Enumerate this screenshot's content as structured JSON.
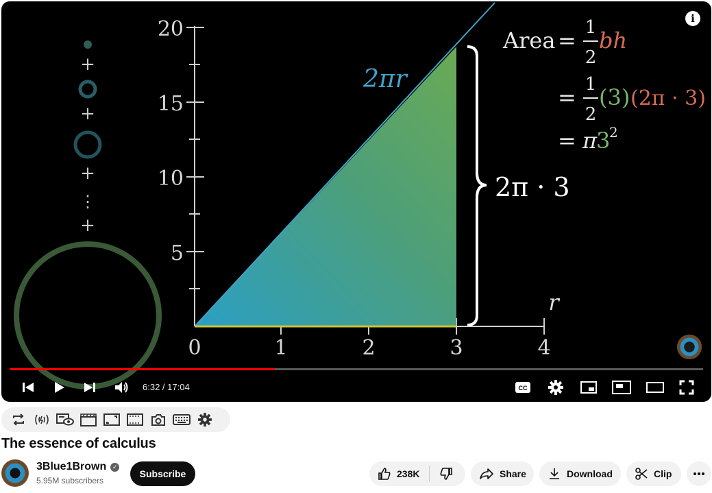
{
  "video": {
    "equations": {
      "area_word": "Area",
      "equals": "=",
      "half_num": "1",
      "half_den": "2",
      "bh": "bh",
      "three_paren": "(3)",
      "two_pi_three_paren": "(2π · 3)",
      "pi": "π",
      "three_sq": "3",
      "sq_exp": "2"
    },
    "labels": {
      "hypotenuse": "2πr",
      "brace": "2π · 3",
      "r_axis": "r"
    },
    "plot": {
      "x_ticks": [
        "0",
        "1",
        "2",
        "3",
        "4"
      ],
      "y_ticks": [
        "5",
        "10",
        "15",
        "20"
      ]
    },
    "info_icon": "i"
  },
  "player": {
    "progress_fraction": 0.382,
    "time_current": "6:32",
    "time_separator": " / ",
    "time_total": "17:04",
    "accent_color": "#ff0000"
  },
  "extension_bar": {
    "icons": [
      "loop-icon",
      "wireless-icon",
      "eye-screen-icon",
      "clapper-icon",
      "frame-icon",
      "cinema-icon",
      "camera-icon",
      "keyboard-icon",
      "gear-icon"
    ]
  },
  "video_title": "The essence of calculus",
  "channel": {
    "name": "3Blue1Brown",
    "subscribers": "5.95M subscribers",
    "subscribe_label": "Subscribe"
  },
  "actions": {
    "likes": "238K",
    "share": "Share",
    "download": "Download",
    "clip": "Clip"
  }
}
